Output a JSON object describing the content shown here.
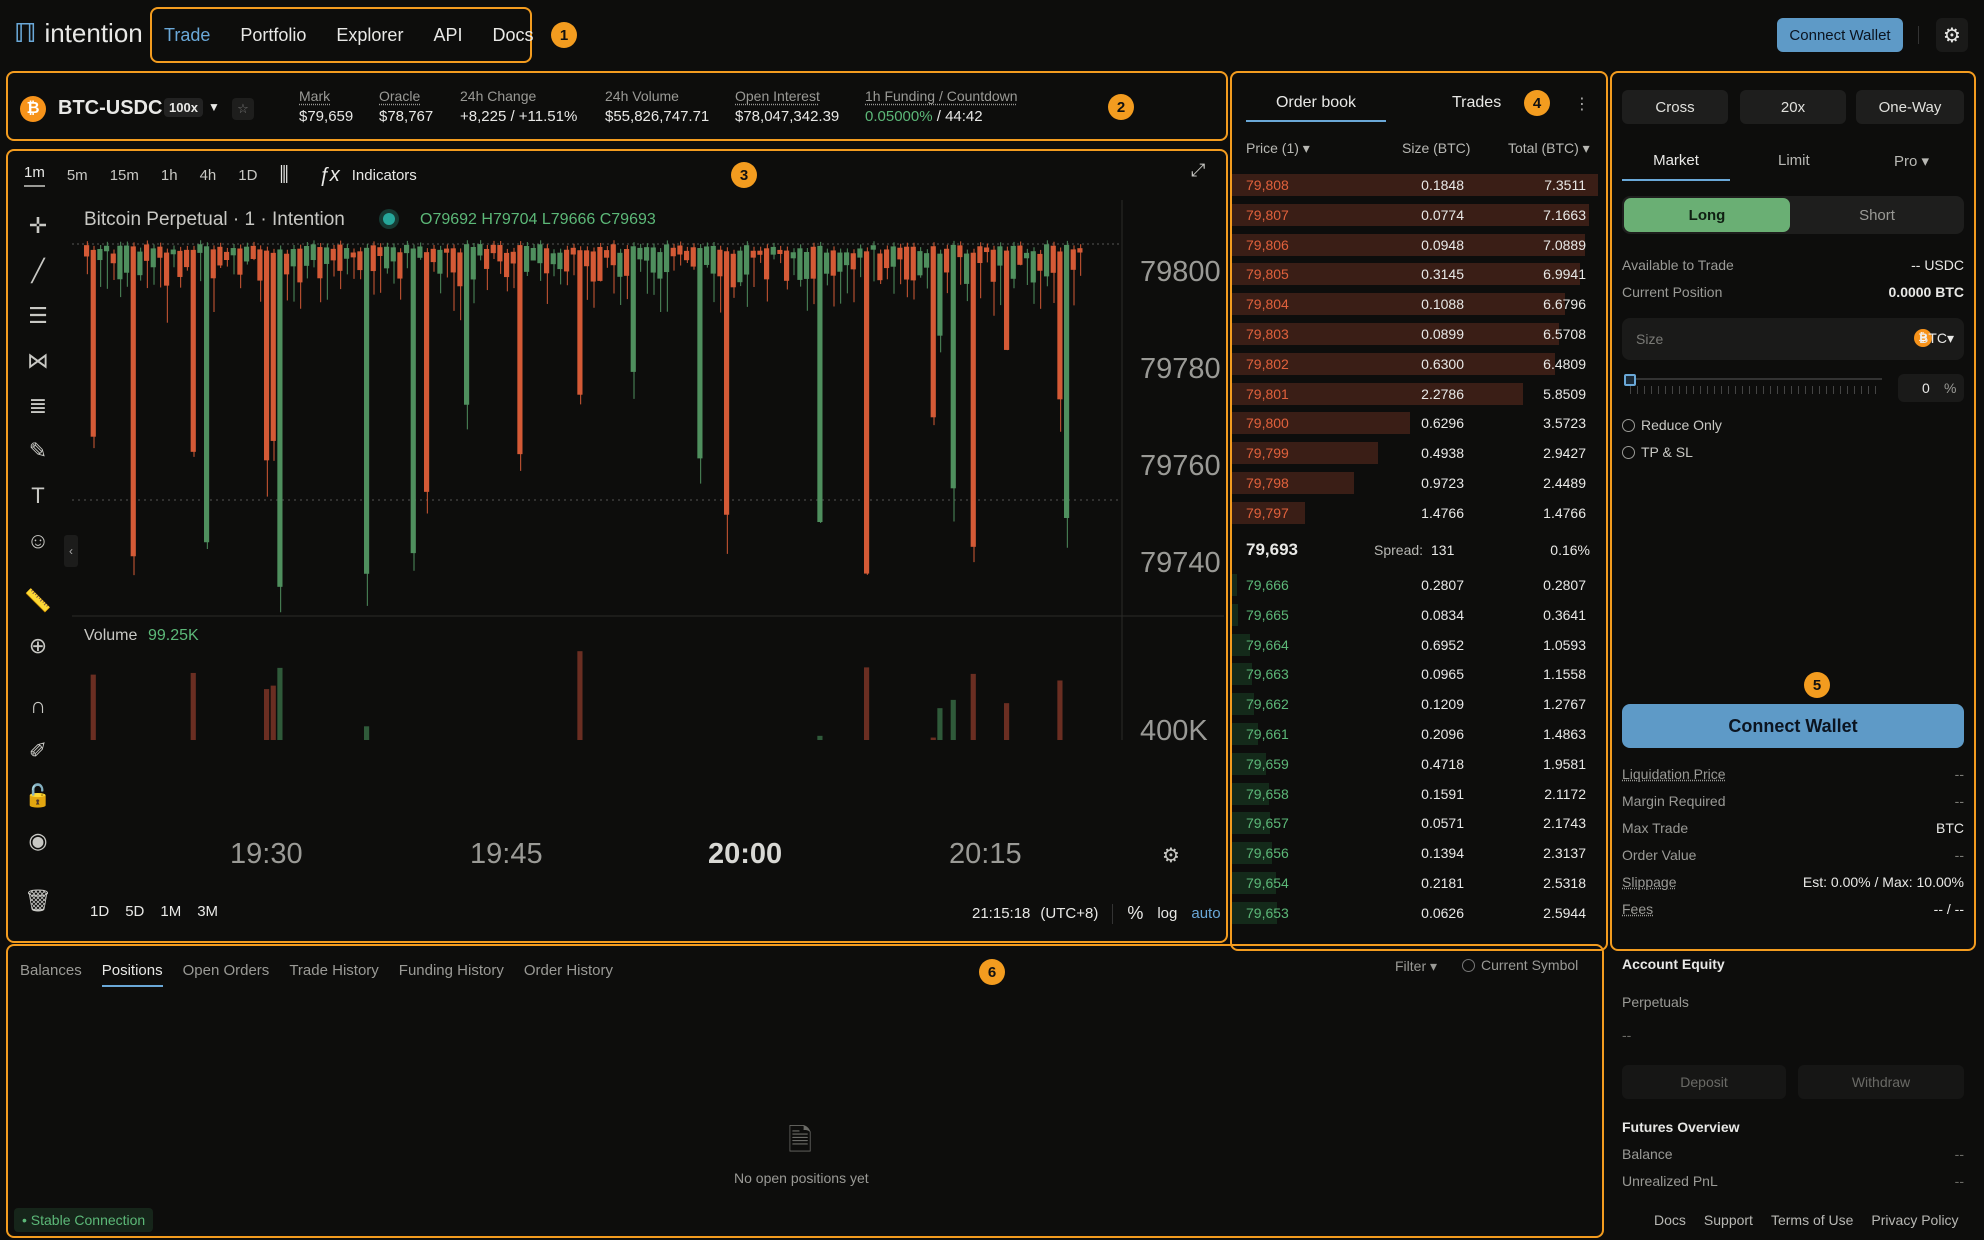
{
  "brand": {
    "name": "intention"
  },
  "nav": {
    "items": [
      "Trade",
      "Portfolio",
      "Explorer",
      "API",
      "Docs"
    ],
    "active": "Trade"
  },
  "header": {
    "connect_wallet": "Connect Wallet"
  },
  "annotations": [
    "1",
    "2",
    "3",
    "4",
    "5",
    "6"
  ],
  "ticker": {
    "coin_symbol": "₿",
    "pair": "BTC-USDC",
    "leverage": "100x",
    "stats": [
      {
        "label": "Mark",
        "value": "$79,659"
      },
      {
        "label": "Oracle",
        "value": "$78,767"
      },
      {
        "label": "24h Change",
        "value": "+8,225 / +11.51%"
      },
      {
        "label": "24h Volume",
        "value": "$55,826,747.71"
      },
      {
        "label": "Open Interest",
        "value": "$78,047,342.39"
      },
      {
        "label": "1h Funding / Countdown",
        "value_rate": "0.05000%",
        "value_countdown": "/ 44:42"
      }
    ]
  },
  "chart": {
    "timeframes": [
      "1m",
      "5m",
      "15m",
      "1h",
      "4h",
      "1D"
    ],
    "active_timeframe": "1m",
    "indicators_label": "Indicators",
    "title": "Bitcoin  Perpetual · 1 · Intention",
    "ohlc": "O79692  H79704  L79666  C79693",
    "volume_label": "Volume",
    "volume_value": "99.25K",
    "price_ticks": [
      "79800",
      "79780",
      "79760",
      "79740"
    ],
    "volume_tick": "400K",
    "time_ticks": [
      "19:30",
      "19:45",
      "20:00",
      "20:15"
    ],
    "ranges": [
      "1D",
      "5D",
      "1M",
      "3M"
    ],
    "clock": "21:15:18",
    "timezone": "(UTC+8)",
    "scale_opts": [
      "%",
      "log",
      "auto"
    ]
  },
  "chart_data": {
    "type": "candlestick",
    "title": "Bitcoin  Perpetual · 1 · Intention",
    "ylim": [
      79730,
      79815
    ],
    "x": [
      "19:30",
      "19:45",
      "20:00",
      "20:15"
    ],
    "volume_unit": "K"
  },
  "orderbook": {
    "tabs": [
      "Order book",
      "Trades"
    ],
    "active_tab": "Order book",
    "headers": {
      "price": "Price (1)",
      "size": "Size (BTC)",
      "total": "Total (BTC)"
    },
    "asks": [
      {
        "price": "79,808",
        "size": "0.1848",
        "total": "7.3511",
        "depth": 1.0
      },
      {
        "price": "79,807",
        "size": "0.0774",
        "total": "7.1663",
        "depth": 0.975
      },
      {
        "price": "79,806",
        "size": "0.0948",
        "total": "7.0889",
        "depth": 0.964
      },
      {
        "price": "79,805",
        "size": "0.3145",
        "total": "6.9941",
        "depth": 0.951
      },
      {
        "price": "79,804",
        "size": "0.1088",
        "total": "6.6796",
        "depth": 0.909
      },
      {
        "price": "79,803",
        "size": "0.0899",
        "total": "6.5708",
        "depth": 0.894
      },
      {
        "price": "79,802",
        "size": "0.6300",
        "total": "6.4809",
        "depth": 0.882
      },
      {
        "price": "79,801",
        "size": "2.2786",
        "total": "5.8509",
        "depth": 0.796
      },
      {
        "price": "79,800",
        "size": "0.6296",
        "total": "3.5723",
        "depth": 0.486
      },
      {
        "price": "79,799",
        "size": "0.4938",
        "total": "2.9427",
        "depth": 0.4
      },
      {
        "price": "79,798",
        "size": "0.9723",
        "total": "2.4489",
        "depth": 0.333
      },
      {
        "price": "79,797",
        "size": "1.4766",
        "total": "1.4766",
        "depth": 0.2
      }
    ],
    "mid_price": "79,693",
    "spread_label": "Spread:",
    "spread_value": "131",
    "spread_pct": "0.16%",
    "bids": [
      {
        "price": "79,666",
        "size": "0.2807",
        "total": "0.2807",
        "depth": 0.04
      },
      {
        "price": "79,665",
        "size": "0.0834",
        "total": "0.3641",
        "depth": 0.05
      },
      {
        "price": "79,664",
        "size": "0.6952",
        "total": "1.0593",
        "depth": 0.144
      },
      {
        "price": "79,663",
        "size": "0.0965",
        "total": "1.1558",
        "depth": 0.157
      },
      {
        "price": "79,662",
        "size": "0.1209",
        "total": "1.2767",
        "depth": 0.174
      },
      {
        "price": "79,661",
        "size": "0.2096",
        "total": "1.4863",
        "depth": 0.202
      },
      {
        "price": "79,659",
        "size": "0.4718",
        "total": "1.9581",
        "depth": 0.266
      },
      {
        "price": "79,658",
        "size": "0.1591",
        "total": "2.1172",
        "depth": 0.288
      },
      {
        "price": "79,657",
        "size": "0.0571",
        "total": "2.1743",
        "depth": 0.296
      },
      {
        "price": "79,656",
        "size": "0.1394",
        "total": "2.3137",
        "depth": 0.315
      },
      {
        "price": "79,654",
        "size": "0.2181",
        "total": "2.5318",
        "depth": 0.344
      },
      {
        "price": "79,653",
        "size": "0.0626",
        "total": "2.5944",
        "depth": 0.353
      }
    ]
  },
  "order_form": {
    "margin_mode": "Cross",
    "leverage": "20x",
    "position_mode": "One-Way",
    "tabs": [
      "Market",
      "Limit",
      "Pro"
    ],
    "active_tab": "Market",
    "sides": [
      "Long",
      "Short"
    ],
    "active_side": "Long",
    "available_label": "Available to Trade",
    "available_value": "-- USDC",
    "position_label": "Current Position",
    "position_value": "0.0000 BTC",
    "size_placeholder": "Size",
    "size_unit": "BTC",
    "slider_pct": "0",
    "pct_sign": "%",
    "reduce_only": "Reduce Only",
    "tp_sl": "TP & SL",
    "connect_wallet": "Connect Wallet",
    "details": [
      {
        "label": "Liquidation Price",
        "value": "--"
      },
      {
        "label": "Margin Required",
        "value": "--"
      },
      {
        "label": "Max Trade",
        "value": "BTC"
      },
      {
        "label": "Order Value",
        "value": "--"
      },
      {
        "label": "Slippage",
        "value": "Est: 0.00% / Max: 10.00%"
      },
      {
        "label": "Fees",
        "value": "-- / --"
      }
    ]
  },
  "positions": {
    "tabs": [
      "Balances",
      "Positions",
      "Open Orders",
      "Trade History",
      "Funding History",
      "Order History"
    ],
    "active_tab": "Positions",
    "filter_label": "Filter",
    "current_symbol": "Current Symbol",
    "empty_text": "No open positions yet",
    "connection_status": "Stable Connection"
  },
  "account": {
    "title": "Account Equity",
    "perpetuals_label": "Perpetuals",
    "perpetuals_value": "--",
    "deposit": "Deposit",
    "withdraw": "Withdraw",
    "futures_title": "Futures Overview",
    "balance_label": "Balance",
    "balance_value": "--",
    "upnl_label": "Unrealized PnL",
    "upnl_value": "--"
  },
  "footer": {
    "links": [
      "Docs",
      "Support",
      "Terms of Use",
      "Privacy Policy"
    ]
  },
  "colors": {
    "accent": "#6aa8d8",
    "up": "#5cb878",
    "down": "#e0613c",
    "highlight": "#f39c1f"
  }
}
